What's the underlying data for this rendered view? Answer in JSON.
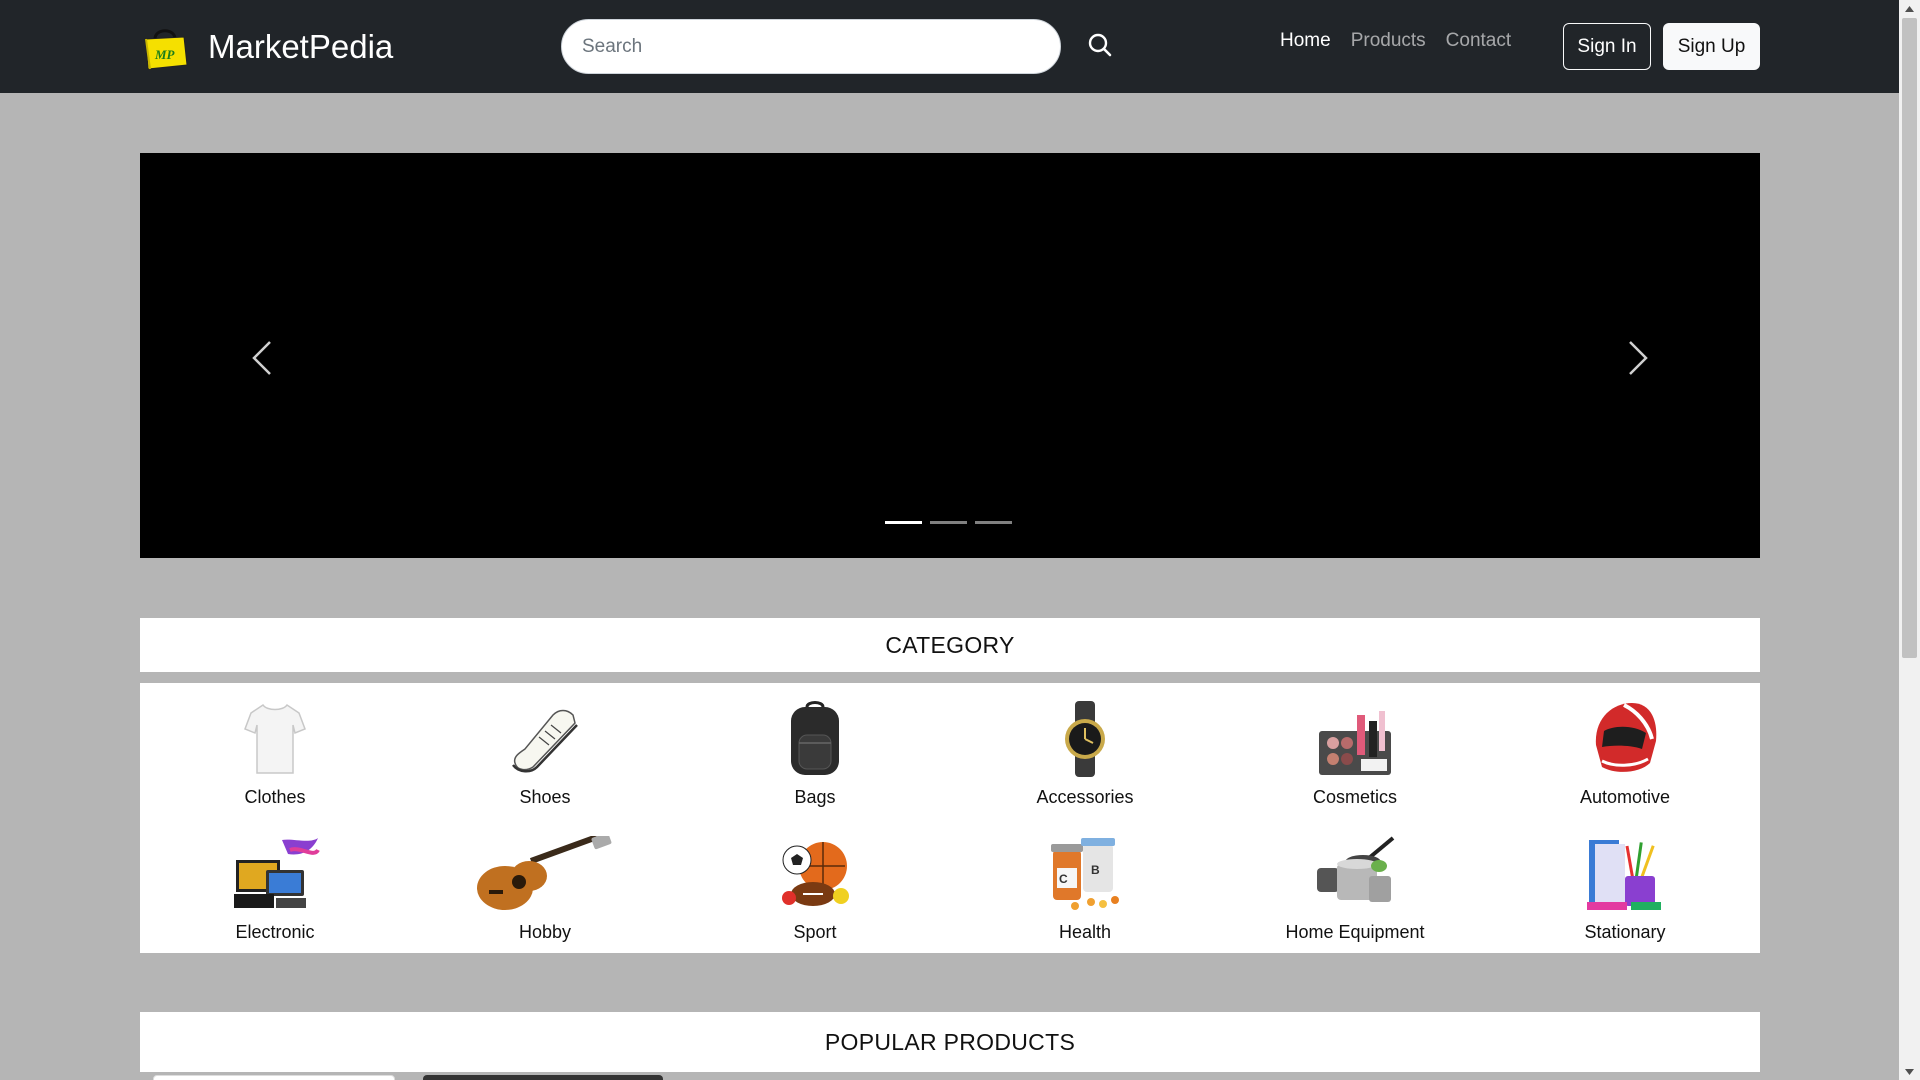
{
  "navbar": {
    "brand_name": "MarketPedia",
    "logo_text": "MP",
    "search_placeholder": "Search",
    "search_icon": "search-icon",
    "links": [
      {
        "label": "Home",
        "active": true
      },
      {
        "label": "Products",
        "active": false
      },
      {
        "label": "Contact",
        "active": false
      }
    ],
    "signin_label": "Sign In",
    "signup_label": "Sign Up"
  },
  "carousel": {
    "slide_count": 3,
    "active_index": 0,
    "prev_icon": "chevron-left-icon",
    "next_icon": "chevron-right-icon"
  },
  "category": {
    "title": "CATEGORY",
    "items": [
      {
        "label": "Clothes",
        "icon": "tshirt-icon"
      },
      {
        "label": "Shoes",
        "icon": "sneaker-icon"
      },
      {
        "label": "Bags",
        "icon": "backpack-icon"
      },
      {
        "label": "Accessories",
        "icon": "watch-icon"
      },
      {
        "label": "Cosmetics",
        "icon": "cosmetics-icon"
      },
      {
        "label": "Automotive",
        "icon": "helmet-icon"
      },
      {
        "label": "Electronic",
        "icon": "electronics-icon"
      },
      {
        "label": "Hobby",
        "icon": "guitar-icon"
      },
      {
        "label": "Sport",
        "icon": "sports-balls-icon"
      },
      {
        "label": "Health",
        "icon": "vitamins-icon"
      },
      {
        "label": "Home Equipment",
        "icon": "cookware-icon"
      },
      {
        "label": "Stationary",
        "icon": "stationery-icon"
      }
    ]
  },
  "popular": {
    "title": "POPULAR PRODUCTS"
  },
  "colors": {
    "navbar_bg": "#212529",
    "page_bg": "#b5b5b5",
    "logo_yellow": "#f5e000"
  }
}
